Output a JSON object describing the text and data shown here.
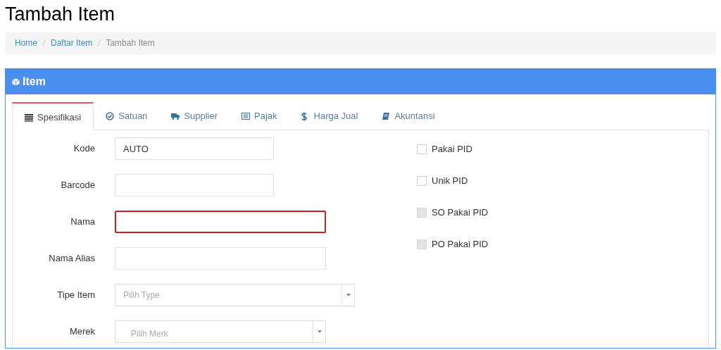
{
  "page_title": "Tambah Item",
  "breadcrumb": [
    {
      "label": "Home",
      "current": false
    },
    {
      "label": "Daftar Item",
      "current": false
    },
    {
      "label": "Tambah Item",
      "current": true
    }
  ],
  "panel": {
    "title": "Item"
  },
  "tabs": [
    {
      "label": "Spesifikasi",
      "selected": true
    },
    {
      "label": "Satuan",
      "selected": false
    },
    {
      "label": "Supplier",
      "selected": false
    },
    {
      "label": "Pajak",
      "selected": false
    },
    {
      "label": "Harga Jual",
      "selected": false
    },
    {
      "label": "Akuntansi",
      "selected": false
    }
  ],
  "fields": [
    {
      "label": "Kode",
      "kind": "input",
      "value": "AUTO",
      "error": false
    },
    {
      "label": "Barcode",
      "kind": "input",
      "error": false
    },
    {
      "label": "Nama",
      "kind": "input",
      "error": true
    },
    {
      "label": "Nama Alias",
      "kind": "input",
      "error": false
    },
    {
      "label": "Tipe Item",
      "kind": "select",
      "placeholder": "Pilih Type"
    },
    {
      "label": "Merek",
      "kind": "select",
      "placeholder": "Pilih Merk"
    }
  ],
  "checkboxes": [
    {
      "label": "Pakai PID",
      "checked": false,
      "disabled": false
    },
    {
      "label": "Unik PID",
      "checked": false,
      "disabled": false
    },
    {
      "label": "SO Pakai PID",
      "checked": false,
      "disabled": true
    },
    {
      "label": "PO Pakai PID",
      "checked": false,
      "disabled": true
    }
  ]
}
